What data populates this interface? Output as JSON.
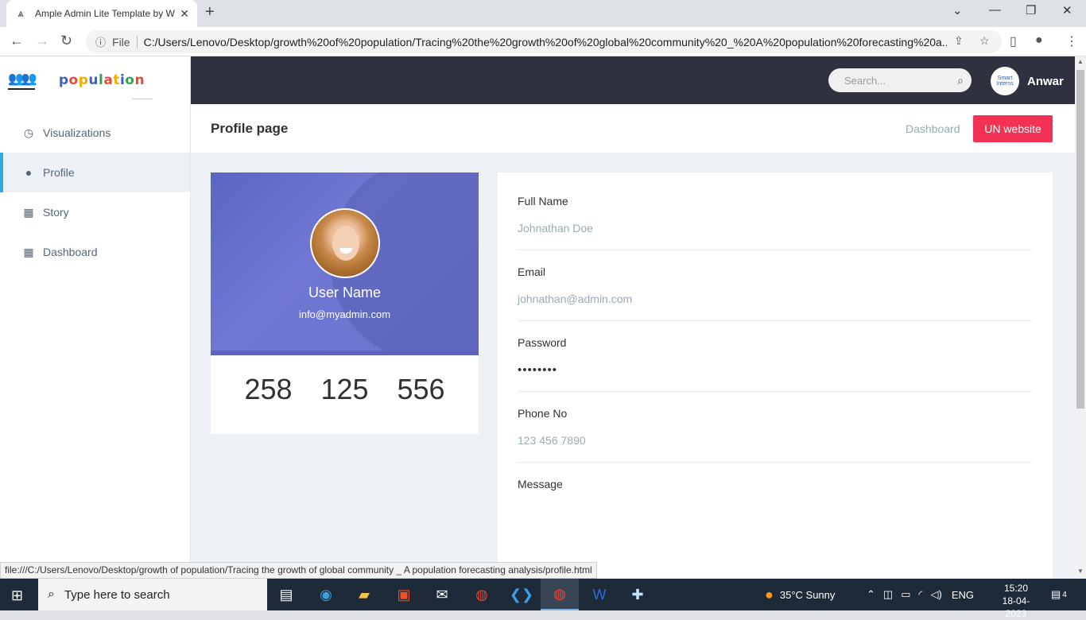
{
  "browser": {
    "tab_title": "Ample Admin Lite Template by W",
    "file_label": "File",
    "url": "C:/Users/Lenovo/Desktop/growth%20of%20population/Tracing%20the%20growth%20of%20global%20community%20_%20A%20population%20forecasting%20a...",
    "status_url": "file:///C:/Users/Lenovo/Desktop/growth of population/Tracing the growth of global community _ A population forecasting analysis/profile.html"
  },
  "brand": {
    "logo_text": [
      "p",
      "o",
      "p",
      "u",
      "l",
      "a",
      "t",
      "i",
      "o",
      "n"
    ]
  },
  "sidebar": {
    "items": [
      {
        "label": "Visualizations",
        "icon": "clock-icon"
      },
      {
        "label": "Profile",
        "icon": "user-icon",
        "active": true
      },
      {
        "label": "Story",
        "icon": "table-icon"
      },
      {
        "label": "Dashboard",
        "icon": "table-icon"
      }
    ]
  },
  "topbar": {
    "search_placeholder": "Search...",
    "user_name": "Anwar",
    "avatar_text": "Smart Interns"
  },
  "header": {
    "title": "Profile page",
    "breadcrumb": "Dashboard",
    "button": "UN website"
  },
  "profile": {
    "name": "User Name",
    "email": "info@myadmin.com",
    "stats": [
      "258",
      "125",
      "556"
    ]
  },
  "form": {
    "full_name": {
      "label": "Full Name",
      "value": "Johnathan Doe"
    },
    "email": {
      "label": "Email",
      "value": "johnathan@admin.com"
    },
    "password": {
      "label": "Password",
      "value": "••••••••"
    },
    "phone": {
      "label": "Phone No",
      "value": "123 456 7890"
    },
    "message": {
      "label": "Message",
      "value": ""
    }
  },
  "taskbar": {
    "search_placeholder": "Type here to search",
    "weather": "35°C  Sunny",
    "lang": "ENG",
    "time": "15:20",
    "date": "18-04-2023",
    "notifications": "4"
  },
  "colors": {
    "topbar": "#2f323e",
    "accent": "#f33155",
    "active_border": "#2cabe3",
    "profile_bg": "#6b73cf"
  }
}
